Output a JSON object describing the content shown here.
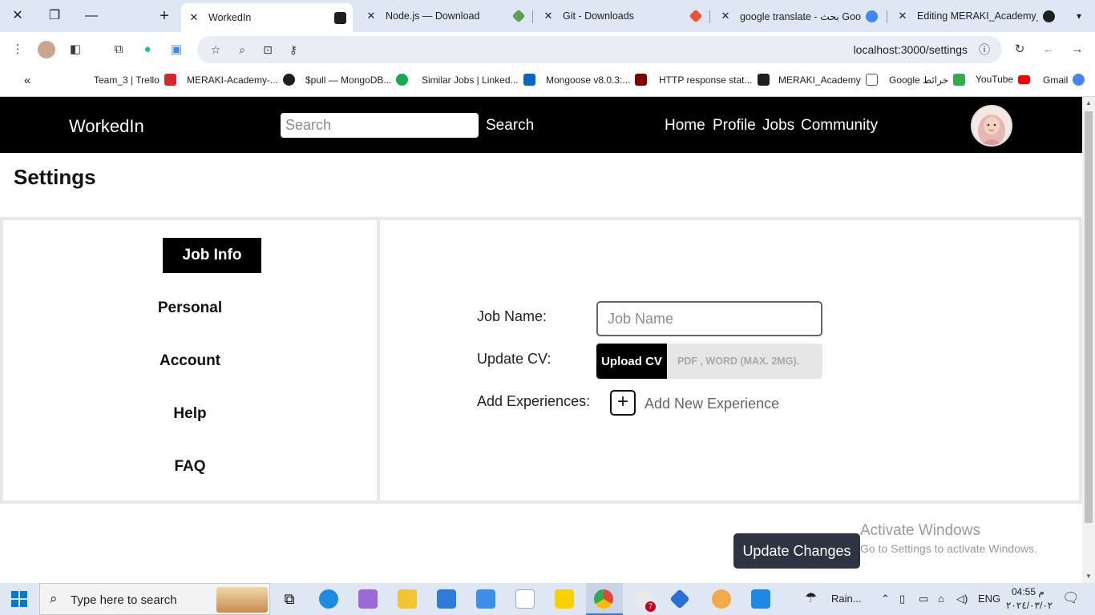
{
  "browser": {
    "tabs": [
      {
        "title": "WorkedIn",
        "active": true
      },
      {
        "title": "Node.js — Download",
        "active": false
      },
      {
        "title": "Git - Downloads",
        "active": false
      },
      {
        "title": "google translate - بحث Goog",
        "active": false
      },
      {
        "title": "Editing MERAKI_Academy_P",
        "active": false
      }
    ],
    "url": "localhost:3000/settings",
    "bookmarks": [
      {
        "label": "Team_3 | Trello",
        "color": "#d9262a"
      },
      {
        "label": "MERAKI-Academy-...",
        "color": "#1f1f1f"
      },
      {
        "label": "$pull — MongoDB...",
        "color": "#13aa52"
      },
      {
        "label": "Similar Jobs | Linked...",
        "color": "#0a66c2"
      },
      {
        "label": "Mongoose v8.0.3:...",
        "color": "#800000"
      },
      {
        "label": "HTTP response stat...",
        "color": "#1f1f1f"
      },
      {
        "label": "MERAKI_Academy",
        "color": "#555555"
      },
      {
        "label": "Google خرائط",
        "color": "#34a853"
      },
      {
        "label": "YouTube",
        "color": "#ff0000"
      },
      {
        "label": "Gmail",
        "color": "#ea4335"
      }
    ]
  },
  "navbar": {
    "brand": "WorkedIn",
    "search_placeholder": "Search",
    "search_button": "Search",
    "links": [
      "Home",
      "Profile",
      "Jobs",
      "Community"
    ]
  },
  "settings": {
    "title": "Settings",
    "menu": [
      "Job Info",
      "Personal",
      "Account",
      "Help",
      "FAQ"
    ],
    "active_menu": "Job Info",
    "form": {
      "job_name_label": "Job Name:",
      "job_name_placeholder": "Job Name",
      "cv_label": "Update CV:",
      "cv_button": "Upload CV",
      "cv_hint": "PDF , WORD (MAX. 2MG).",
      "experience_label": "Add Experiences:",
      "experience_button": "Add New Experience"
    },
    "update_button": "Update Changes"
  },
  "watermark": {
    "title": "Activate Windows",
    "subtitle": "Go to Settings to activate Windows."
  },
  "taskbar": {
    "search_placeholder": "Type here to search",
    "weather": "Rain...",
    "language": "ENG",
    "time": "04:55 م",
    "date": "٢٠٢٤/٠٣/٠٢",
    "chrome_badge": "7"
  }
}
